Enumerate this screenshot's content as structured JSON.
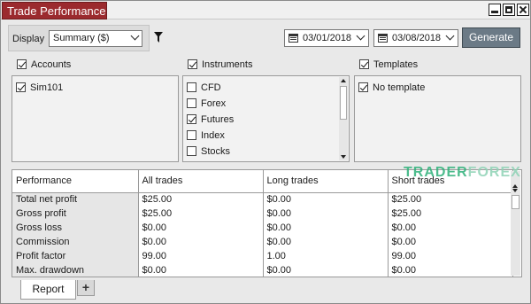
{
  "window": {
    "title": "Trade Performance"
  },
  "toolbar": {
    "display_label": "Display",
    "display_value": "Summary ($)",
    "date_from": "03/01/2018",
    "date_to": "03/08/2018",
    "generate_label": "Generate"
  },
  "groups": {
    "accounts": {
      "label": "Accounts",
      "items": [
        {
          "label": "Sim101",
          "checked": true
        }
      ]
    },
    "instruments": {
      "label": "Instruments",
      "items": [
        {
          "label": "CFD",
          "checked": false
        },
        {
          "label": "Forex",
          "checked": false
        },
        {
          "label": "Futures",
          "checked": true
        },
        {
          "label": "Index",
          "checked": false
        },
        {
          "label": "Stocks",
          "checked": false
        }
      ]
    },
    "templates": {
      "label": "Templates",
      "items": [
        {
          "label": "No template",
          "checked": true
        }
      ]
    }
  },
  "grid": {
    "headers": [
      "Performance",
      "All trades",
      "Long trades",
      "Short trades"
    ],
    "rows": [
      [
        "Total net profit",
        "$25.00",
        "$0.00",
        "$25.00"
      ],
      [
        "Gross profit",
        "$25.00",
        "$0.00",
        "$25.00"
      ],
      [
        "Gross loss",
        "$0.00",
        "$0.00",
        "$0.00"
      ],
      [
        "Commission",
        "$0.00",
        "$0.00",
        "$0.00"
      ],
      [
        "Profit factor",
        "99.00",
        "1.00",
        "99.00"
      ],
      [
        "Max. drawdown",
        "$0.00",
        "$0.00",
        "$0.00"
      ]
    ]
  },
  "watermark": {
    "part1": "TRADER",
    "part2": "FOREX"
  },
  "tabs": {
    "report": "Report",
    "add": "+"
  },
  "colors": {
    "title_tab": "#9b2a2e",
    "generate_button": "#6b7a86",
    "watermark": "#2fb17a"
  }
}
